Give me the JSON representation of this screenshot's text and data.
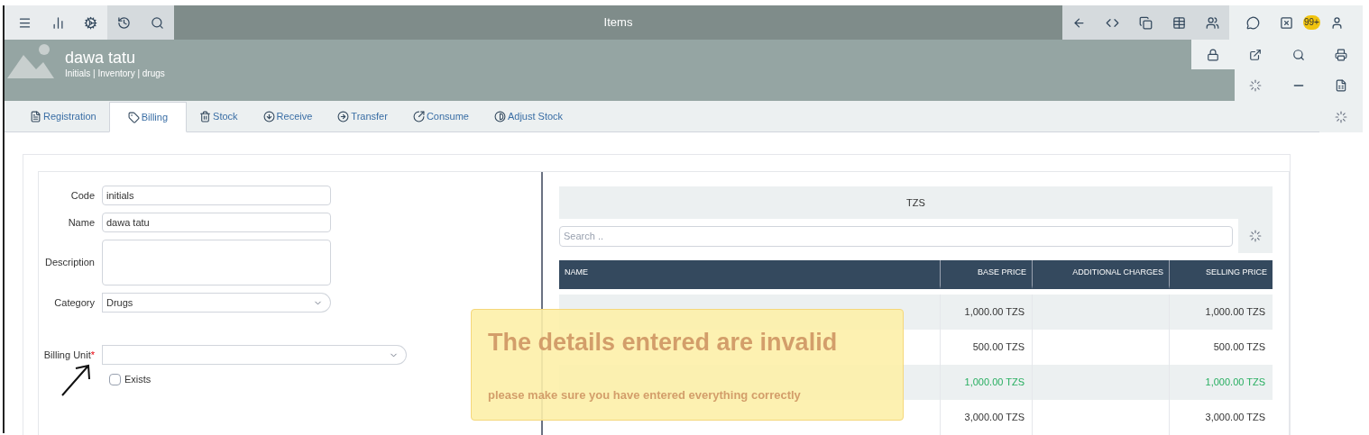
{
  "toolbar": {
    "title": "Items",
    "notification_badge": "99+"
  },
  "header": {
    "name": "dawa tatu",
    "breadcrumb": "Initials | Inventory | drugs"
  },
  "tabs": [
    {
      "label": "Registration",
      "selected": false
    },
    {
      "label": "Billing",
      "selected": true
    },
    {
      "label": "Stock",
      "selected": false
    },
    {
      "label": "Receive",
      "selected": false
    },
    {
      "label": "Transfer",
      "selected": false
    },
    {
      "label": "Consume",
      "selected": false
    },
    {
      "label": "Adjust Stock",
      "selected": false
    }
  ],
  "form": {
    "fields": [
      {
        "label": "Code",
        "kind": "text",
        "value": "initials"
      },
      {
        "label": "Name",
        "kind": "text",
        "value": "dawa tatu"
      },
      {
        "label": "Description",
        "kind": "textarea"
      },
      {
        "label": "Category",
        "kind": "select",
        "value": "Drugs"
      },
      {
        "label": "Billing Unit",
        "kind": "select",
        "required_mark": "*"
      }
    ],
    "checkbox": {
      "label": "Exists",
      "checked": false
    }
  },
  "price_panel": {
    "title": "TZS",
    "search": {
      "placeholder": "Search .."
    },
    "columns": [
      "NAME",
      "BASE PRICE",
      "ADDITIONAL CHARGES",
      "SELLING PRICE"
    ],
    "rows": [
      {
        "base_price": "1,000.00 TZS",
        "selling_price": "1,000.00 TZS",
        "highlighted": false
      },
      {
        "base_price": "500.00 TZS",
        "selling_price": "500.00 TZS",
        "highlighted": false
      },
      {
        "base_price": "1,000.00 TZS",
        "selling_price": "1,000.00 TZS",
        "highlighted": true
      },
      {
        "base_price": "3,000.00 TZS",
        "selling_price": "3,000.00 TZS",
        "highlighted": false
      }
    ]
  },
  "toast": {
    "title": "The details entered are invalid",
    "message": "please make sure you have entered everything correctly"
  }
}
